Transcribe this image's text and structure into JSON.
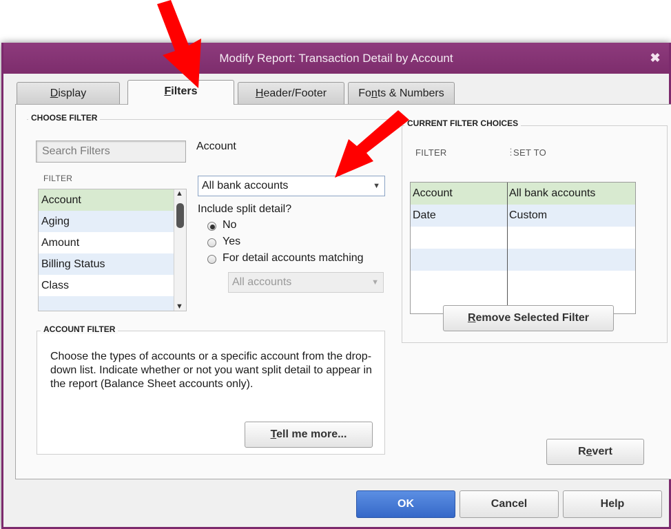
{
  "window": {
    "title": "Modify Report: Transaction Detail by Account",
    "close_glyph": "✖"
  },
  "tabs": [
    {
      "pre": "",
      "ul": "D",
      "post": "isplay",
      "active": false
    },
    {
      "pre": "",
      "ul": "F",
      "post": "ilters",
      "active": true
    },
    {
      "pre": "",
      "ul": "H",
      "post": "eader/Footer",
      "active": false
    },
    {
      "pre": "Fo",
      "ul": "n",
      "post": "ts & Numbers",
      "active": false
    }
  ],
  "choose_filter": {
    "group_label": "CHOOSE FILTER",
    "search_placeholder": "Search Filters",
    "list_header": "FILTER",
    "items": [
      "Account",
      "Aging",
      "Amount",
      "Billing Status",
      "Class"
    ],
    "selected": "Account"
  },
  "account_panel": {
    "label": "Account",
    "selected_value": "All bank accounts",
    "split_question": "Include split detail?",
    "radios": [
      {
        "label": "No",
        "checked": true
      },
      {
        "label": "Yes",
        "checked": false
      },
      {
        "label": "For detail accounts matching",
        "checked": false
      }
    ],
    "match_value": "All accounts"
  },
  "account_filter": {
    "group_label": "ACCOUNT FILTER",
    "description": "Choose the types of accounts or a specific account from the drop-down list. Indicate whether or not you want split detail to appear in the report (Balance Sheet accounts only).",
    "tell_more": {
      "ul": "T",
      "post": "ell me more..."
    }
  },
  "current_filters": {
    "group_label": "CURRENT FILTER CHOICES",
    "col_filter": "FILTER",
    "col_set_to": "SET TO",
    "rows": [
      {
        "filter": "Account",
        "set_to": "All bank accounts"
      },
      {
        "filter": "Date",
        "set_to": "Custom"
      }
    ],
    "remove_button": {
      "ul": "R",
      "post": "emove Selected Filter"
    }
  },
  "buttons": {
    "revert": {
      "pre": "R",
      "ul": "e",
      "post": "vert"
    },
    "ok": "OK",
    "cancel": "Cancel",
    "help": "Help"
  },
  "colors": {
    "titlebar": "#7d2d6c",
    "selected_row": "#d8ead0",
    "alt_row": "#e5eef9",
    "ok_button": "#3568c8",
    "arrow": "#ff0000"
  }
}
